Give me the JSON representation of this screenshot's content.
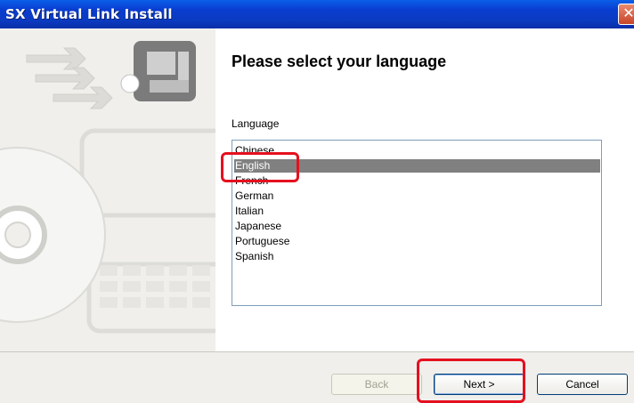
{
  "window": {
    "title": "SX Virtual Link Install",
    "close_glyph": "✕"
  },
  "page": {
    "heading": "Please select your language",
    "language_label": "Language",
    "languages": [
      "Chinese",
      "English",
      "French",
      "German",
      "Italian",
      "Japanese",
      "Portuguese",
      "Spanish"
    ],
    "selected": "English"
  },
  "footer": {
    "back_label": "Back",
    "next_label": "Next >",
    "cancel_label": "Cancel"
  },
  "colors": {
    "selection": "#808080",
    "highlight": "#e5101f",
    "titlebar": "#0a3ccf"
  }
}
